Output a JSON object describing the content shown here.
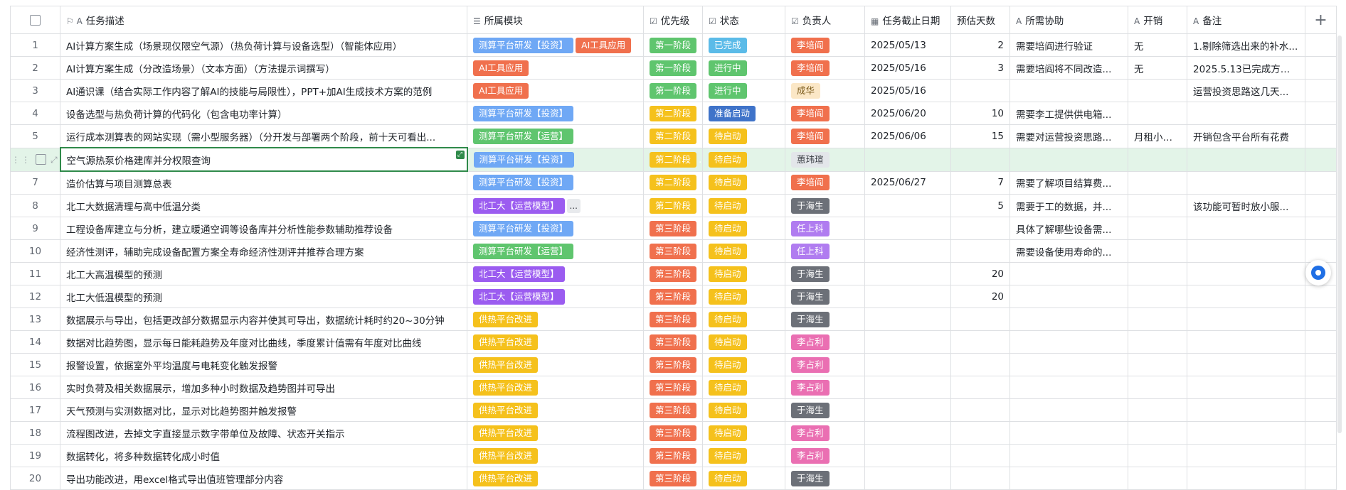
{
  "columns": [
    {
      "key": "checkbox",
      "label": ""
    },
    {
      "key": "desc",
      "label": "任务描述",
      "icon": "flag-text-icon"
    },
    {
      "key": "module",
      "label": "所属模块",
      "icon": "multi-select-icon"
    },
    {
      "key": "priority",
      "label": "优先级",
      "icon": "single-select-icon"
    },
    {
      "key": "status",
      "label": "状态",
      "icon": "single-select-icon"
    },
    {
      "key": "owner",
      "label": "负责人",
      "icon": "single-select-icon"
    },
    {
      "key": "deadline",
      "label": "任务截止日期",
      "icon": "calendar-icon"
    },
    {
      "key": "days",
      "label": "预估天数",
      "icon": ""
    },
    {
      "key": "assist",
      "label": "所需协助",
      "icon": "text-icon"
    },
    {
      "key": "cost",
      "label": "开销",
      "icon": "text-icon"
    },
    {
      "key": "note",
      "label": "备注",
      "icon": "text-icon"
    }
  ],
  "add_column_label": "+",
  "tag_colors": {
    "测算平台研发【投资】": "#6fa8f5",
    "AI工具应用": "#f0704d",
    "测算平台研发【运营】": "#5fc56e",
    "北工大【运营模型】": "#9b5cf0",
    "供热平台改进": "#f5c11c",
    "第一阶段": "#5fc56e",
    "第二阶段": "#f5c11c",
    "第三阶段": "#f0704d",
    "已完成": "#5bbbe8",
    "进行中": "#5fc56e",
    "准备启动": "#3f73c9",
    "待启动": "#f5c11c",
    "李培阎": "#f0704d",
    "成华": "#fbe7c6",
    "蕙玮瑄": "#e3e6ea",
    "于海生": "#6c7078",
    "任上科": "#b07cf0",
    "李占利": "#ea6fb2"
  },
  "rows": [
    {
      "n": "1",
      "desc": "AI计算方案生成（场景现仅限空气源）（热负荷计算与设备选型）（智能体应用）",
      "module": [
        "测算平台研发【投资】",
        "AI工具应用"
      ],
      "priority": "第一阶段",
      "status": "已完成",
      "owner": "李培阎",
      "deadline": "2025/05/13",
      "days": "2",
      "assist": "需要培阎进行验证",
      "cost": "无",
      "note": "1.剔除筛选出来的补水..."
    },
    {
      "n": "2",
      "desc": "AI计算方案生成（分改造场景）（文本方面）（方法提示词撰写）",
      "module": [
        "AI工具应用"
      ],
      "priority": "第一阶段",
      "status": "进行中",
      "owner": "李培阎",
      "deadline": "2025/05/16",
      "days": "3",
      "assist": "需要培阎将不同改造...",
      "cost": "无",
      "note": "2025.5.13已完成方案..."
    },
    {
      "n": "3",
      "desc": "AI通识课（结合实际工作内容了解AI的技能与局限性），PPT+加AI生成技术方案的范例",
      "module": [
        "AI工具应用"
      ],
      "priority": "第一阶段",
      "status": "进行中",
      "owner": "成华",
      "deadline": "2025/05/16",
      "days": "",
      "assist": "",
      "cost": "",
      "note": "运营投资思路这几天..."
    },
    {
      "n": "4",
      "desc": "设备选型与热负荷计算的代码化（包含电功率计算）",
      "module": [
        "测算平台研发【投资】"
      ],
      "priority": "第二阶段",
      "status": "准备启动",
      "owner": "李培阎",
      "deadline": "2025/06/20",
      "days": "10",
      "assist": "需要李工提供供电箱...",
      "cost": "",
      "note": ""
    },
    {
      "n": "5",
      "desc": "运行成本测算表的网站实现（需小型服务器）（分开发与部署两个阶段，前十天可看出...",
      "module": [
        "测算平台研发【运营】"
      ],
      "priority": "第二阶段",
      "status": "待启动",
      "owner": "李培阎",
      "deadline": "2025/06/06",
      "days": "15",
      "assist": "需要对运营投资思路...",
      "cost": "月租小于...",
      "note": "开销包含平台所有花费"
    },
    {
      "n": "",
      "desc": "空气源热泵价格建库并分权限查询",
      "module": [
        "测算平台研发【投资】"
      ],
      "priority": "第二阶段",
      "status": "待启动",
      "owner": "蕙玮瑄",
      "deadline": "",
      "days": "",
      "assist": "",
      "cost": "",
      "note": ""
    },
    {
      "n": "7",
      "desc": "造价估算与项目测算总表",
      "module": [
        "测算平台研发【投资】"
      ],
      "priority": "第二阶段",
      "status": "待启动",
      "owner": "李培阎",
      "deadline": "2025/06/27",
      "days": "7",
      "assist": "需要了解项目结算费...",
      "cost": "",
      "note": ""
    },
    {
      "n": "8",
      "desc": "北工大数据清理与高中低温分类",
      "module": [
        "北工大【运营模型】"
      ],
      "more": "...",
      "priority": "第二阶段",
      "status": "待启动",
      "owner": "于海生",
      "deadline": "",
      "days": "5",
      "assist": "需要于工的数据，并...",
      "cost": "",
      "note": "该功能可暂时放小服..."
    },
    {
      "n": "9",
      "desc": "工程设备库建立与分析，建立暖通空调等设备库并分析性能参数辅助推荐设备",
      "module": [
        "测算平台研发【投资】"
      ],
      "priority": "第三阶段",
      "status": "待启动",
      "owner": "任上科",
      "deadline": "",
      "days": "",
      "assist": "具体了解哪些设备需...",
      "cost": "",
      "note": ""
    },
    {
      "n": "10",
      "desc": "经济性测评，辅助完成设备配置方案全寿命经济性测评并推荐合理方案",
      "module": [
        "测算平台研发【运营】"
      ],
      "priority": "第三阶段",
      "status": "待启动",
      "owner": "任上科",
      "deadline": "",
      "days": "",
      "assist": "需要设备使用寿命的...",
      "cost": "",
      "note": ""
    },
    {
      "n": "11",
      "desc": "北工大高温模型的预测",
      "module": [
        "北工大【运营模型】"
      ],
      "priority": "第三阶段",
      "status": "待启动",
      "owner": "于海生",
      "deadline": "",
      "days": "20",
      "assist": "",
      "cost": "",
      "note": ""
    },
    {
      "n": "12",
      "desc": "北工大低温模型的预测",
      "module": [
        "北工大【运营模型】"
      ],
      "priority": "第三阶段",
      "status": "待启动",
      "owner": "于海生",
      "deadline": "",
      "days": "20",
      "assist": "",
      "cost": "",
      "note": ""
    },
    {
      "n": "13",
      "desc": "数据展示与导出，包括更改部分数据显示内容并使其可导出，数据统计耗时约20~30分钟",
      "module": [
        "供热平台改进"
      ],
      "priority": "第三阶段",
      "status": "待启动",
      "owner": "于海生",
      "deadline": "",
      "days": "",
      "assist": "",
      "cost": "",
      "note": ""
    },
    {
      "n": "14",
      "desc": "数据对比趋势图，显示每日能耗趋势及年度对比曲线，季度累计值需有年度对比曲线",
      "module": [
        "供热平台改进"
      ],
      "priority": "第三阶段",
      "status": "待启动",
      "owner": "李占利",
      "deadline": "",
      "days": "",
      "assist": "",
      "cost": "",
      "note": ""
    },
    {
      "n": "15",
      "desc": "报警设置，依据室外平均温度与电耗变化触发报警",
      "module": [
        "供热平台改进"
      ],
      "priority": "第三阶段",
      "status": "待启动",
      "owner": "李占利",
      "deadline": "",
      "days": "",
      "assist": "",
      "cost": "",
      "note": ""
    },
    {
      "n": "16",
      "desc": "实时负荷及相关数据展示，增加多种小时数据及趋势图并可导出",
      "module": [
        "供热平台改进"
      ],
      "priority": "第三阶段",
      "status": "待启动",
      "owner": "李占利",
      "deadline": "",
      "days": "",
      "assist": "",
      "cost": "",
      "note": ""
    },
    {
      "n": "17",
      "desc": "天气预测与实测数据对比，显示对比趋势图并触发报警",
      "module": [
        "供热平台改进"
      ],
      "priority": "第三阶段",
      "status": "待启动",
      "owner": "于海生",
      "deadline": "",
      "days": "",
      "assist": "",
      "cost": "",
      "note": ""
    },
    {
      "n": "18",
      "desc": "流程图改进，去掉文字直接显示数字带单位及故障、状态开关指示",
      "module": [
        "供热平台改进"
      ],
      "priority": "第三阶段",
      "status": "待启动",
      "owner": "李占利",
      "deadline": "",
      "days": "",
      "assist": "",
      "cost": "",
      "note": ""
    },
    {
      "n": "19",
      "desc": "数据转化，将多种数据转化成小时值",
      "module": [
        "供热平台改进"
      ],
      "priority": "第三阶段",
      "status": "待启动",
      "owner": "李占利",
      "deadline": "",
      "days": "",
      "assist": "",
      "cost": "",
      "note": ""
    },
    {
      "n": "20",
      "desc": "导出功能改进，用excel格式导出值班管理部分内容",
      "module": [
        "供热平台改进"
      ],
      "priority": "第三阶段",
      "status": "待启动",
      "owner": "于海生",
      "deadline": "",
      "days": "",
      "assist": "",
      "cost": "",
      "note": ""
    }
  ]
}
